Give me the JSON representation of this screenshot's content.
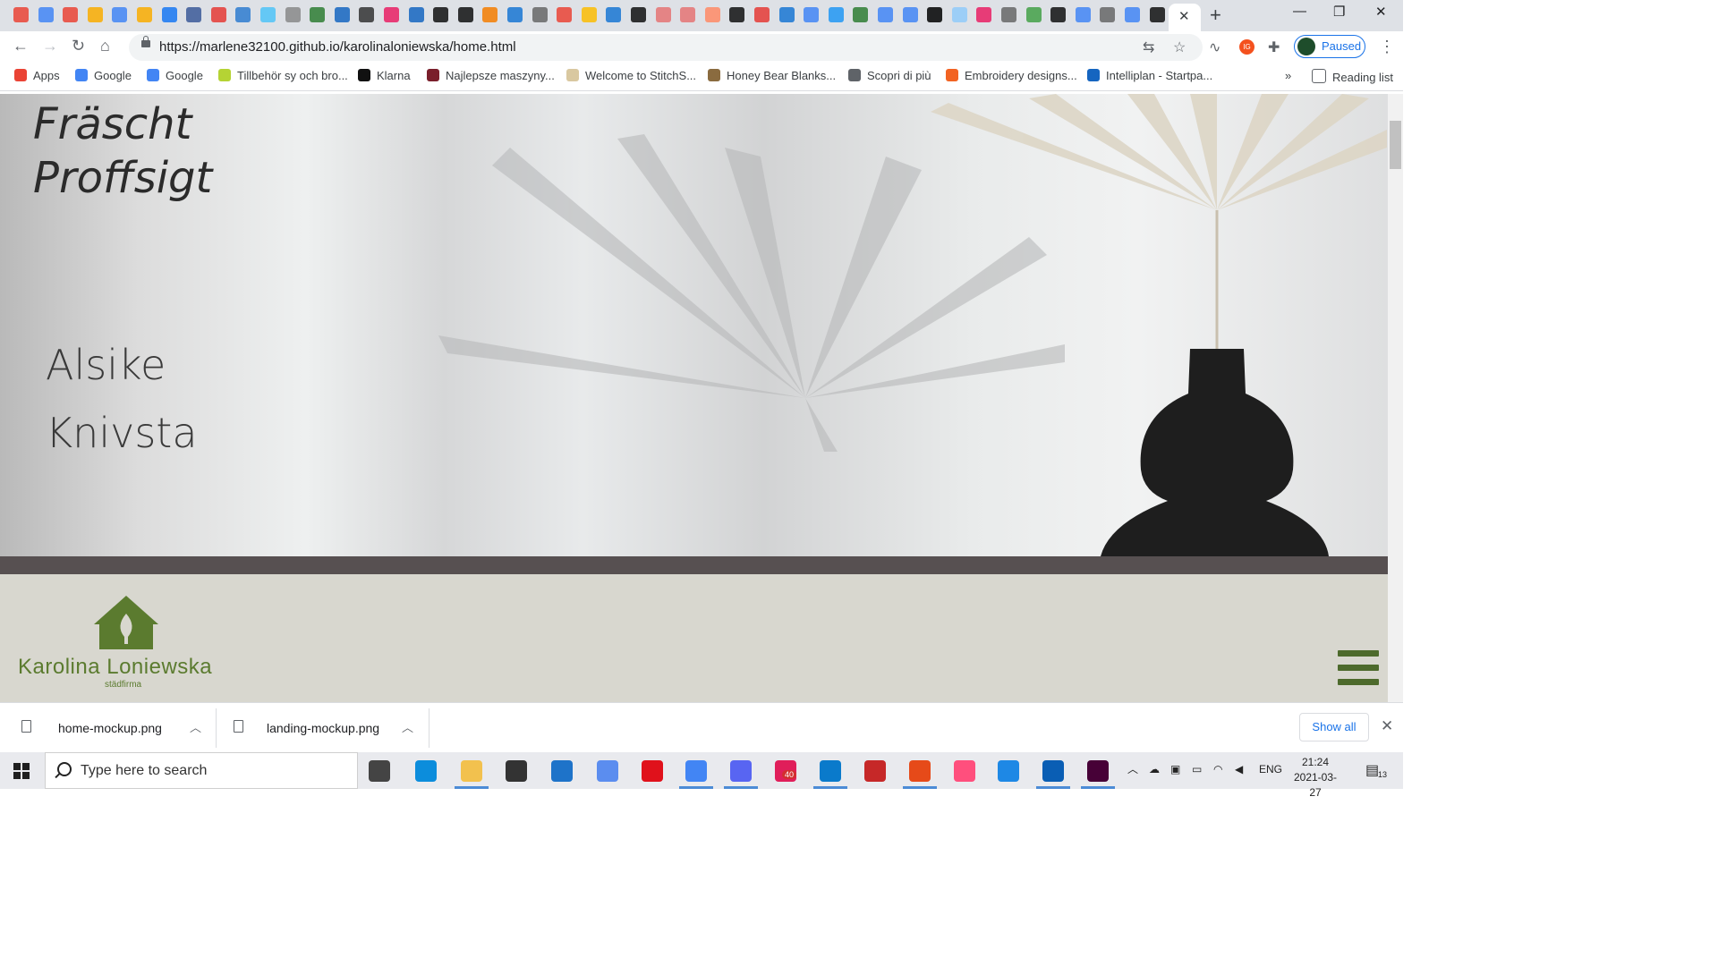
{
  "browser": {
    "active_tab_close": "✕",
    "new_tab": "+",
    "window_controls": [
      "—",
      "❐",
      "✕"
    ],
    "url": "https://marlene32100.github.io/karolinaloniewska/home.html",
    "profile_label": "Paused",
    "extension_badge": "IG",
    "reading_list": "Reading list",
    "bookmark_overflow": "»",
    "bookmarks": [
      {
        "label": "Apps",
        "color": "#ea4335"
      },
      {
        "label": "Google",
        "color": "#4285f4"
      },
      {
        "label": "Google",
        "color": "#4285f4"
      },
      {
        "label": "Tillbehör sy och bro...",
        "color": "#b5d334"
      },
      {
        "label": "Klarna",
        "color": "#111111"
      },
      {
        "label": "Najlepsze maszyny...",
        "color": "#7a1f2b"
      },
      {
        "label": "Welcome to StitchS...",
        "color": "#d9c8a0"
      },
      {
        "label": "Honey Bear Blanks...",
        "color": "#8a6b3f"
      },
      {
        "label": "Scopri di più",
        "color": "#5f6368"
      },
      {
        "label": "Embroidery designs...",
        "color": "#f26322"
      },
      {
        "label": "Intelliplan - Startpa...",
        "color": "#1565c0"
      }
    ]
  },
  "page": {
    "hero_title_line1": "Fräscht",
    "hero_title_line2": "Proffsigt",
    "hero_sub_line1": "Alsike",
    "hero_sub_line2": "Knivsta",
    "logo_name": "Karolina Loniewska",
    "logo_sub": "städfirma",
    "brand_color": "#5b7b2f",
    "bar_color": "#575051",
    "band_color": "#d8d7cf"
  },
  "downloads": {
    "items": [
      {
        "name": "home-mockup.png"
      },
      {
        "name": "landing-mockup.png"
      }
    ],
    "show_all": "Show all",
    "close": "✕"
  },
  "taskbar": {
    "search_placeholder": "Type here to search",
    "slack_badge": "40",
    "language": "ENG",
    "time": "21:24",
    "date": "2021-03-27",
    "notification_count": "13"
  }
}
